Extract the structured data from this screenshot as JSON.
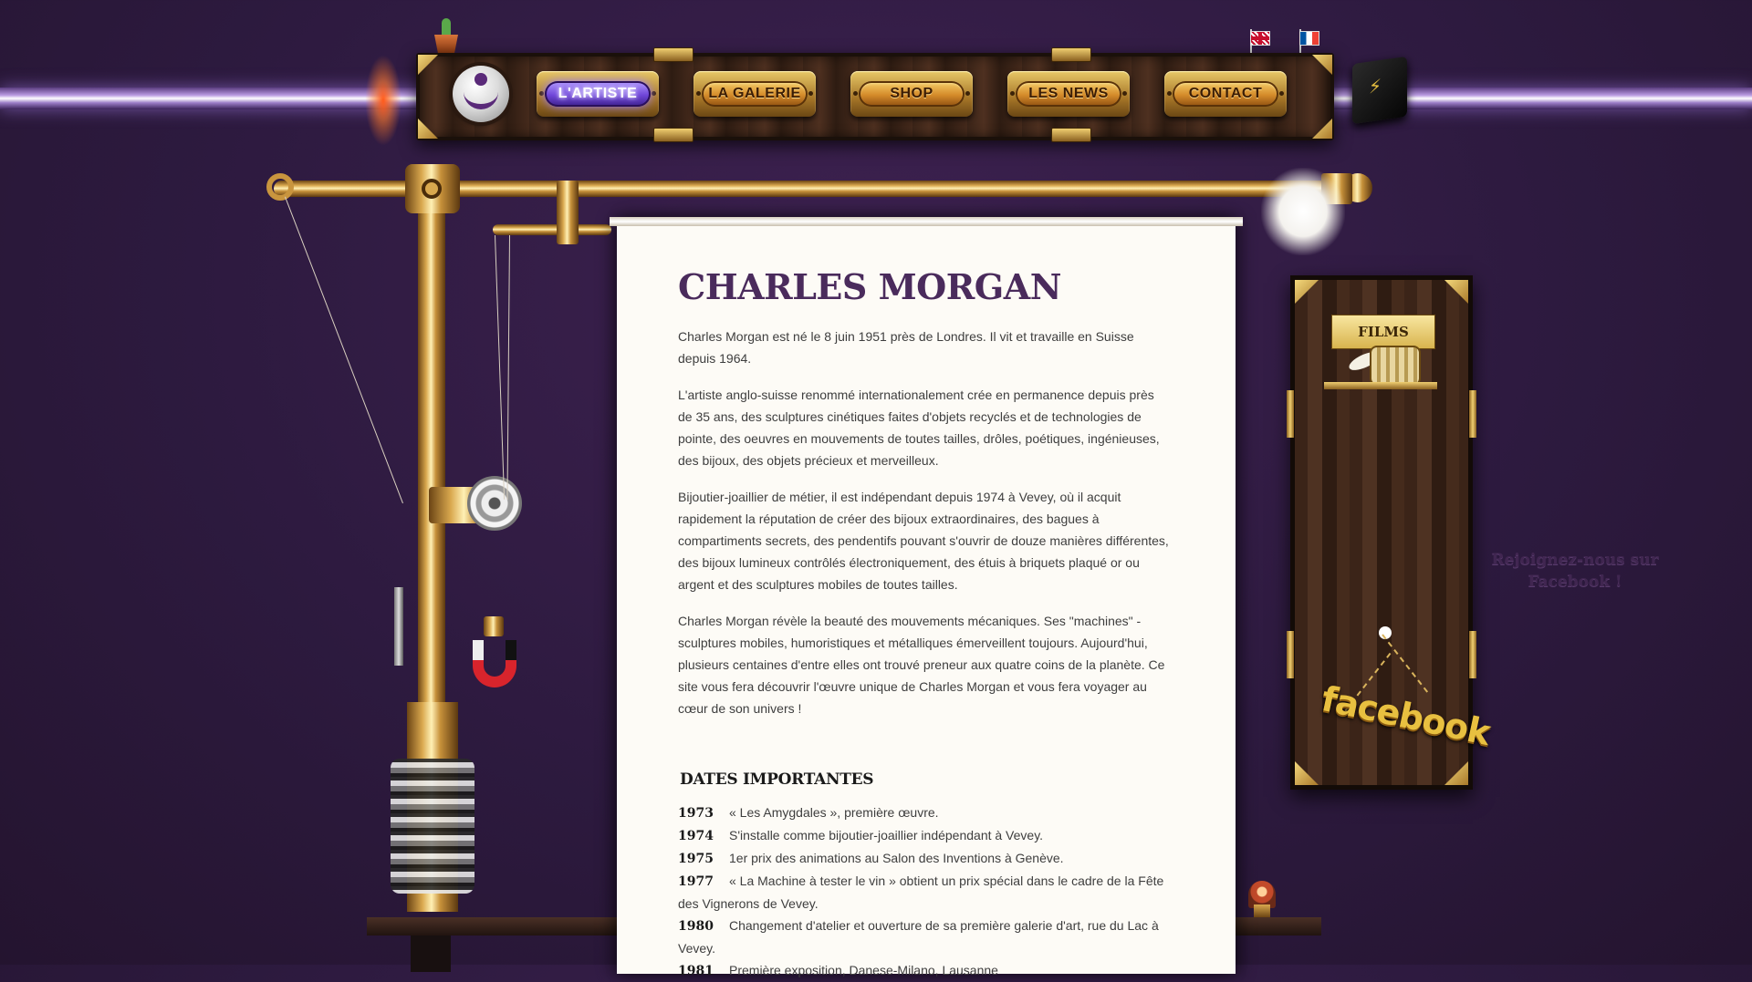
{
  "nav": {
    "items": [
      {
        "label": "L'ARTISTE",
        "active": true
      },
      {
        "label": "LA GALERIE",
        "active": false
      },
      {
        "label": "SHOP",
        "active": false
      },
      {
        "label": "LES NEWS",
        "active": false
      },
      {
        "label": "CONTACT",
        "active": false
      }
    ]
  },
  "languages": [
    "English",
    "Français"
  ],
  "article": {
    "title": "CHARLES MORGAN",
    "paragraphs": [
      "Charles Morgan est né le 8 juin 1951 près de Londres. Il vit et travaille en Suisse depuis 1964.",
      "L'artiste anglo-suisse renommé internationalement crée en permanence depuis près de 35 ans, des sculptures cinétiques faites d'objets recyclés et de technologies de pointe, des oeuvres en mouvements de toutes tailles, drôles, poétiques, ingénieuses, des bijoux, des objets précieux et merveilleux.",
      "Bijoutier-joaillier de métier, il est indépendant depuis 1974 à Vevey, où il acquit rapidement la réputation de créer des bijoux extraordinaires, des bagues à compartiments secrets, des pendentifs pouvant s'ouvrir de douze manières différentes, des bijoux lumineux contrôlés électroniquement, des étuis à briquets plaqué or ou argent et des sculptures mobiles de toutes tailles.",
      "Charles Morgan révèle la beauté des mouvements mécaniques. Ses \"machines\" - sculptures mobiles, humoristiques et métalliques émerveillent toujours. Aujourd'hui, plusieurs centaines d'entre elles ont trouvé preneur aux quatre coins de la planète. Ce site vous fera découvrir l'œuvre unique de Charles Morgan et vous fera voyager au cœur de son univers !"
    ],
    "dates_title": "DATES IMPORTANTES",
    "dates": [
      {
        "year": "1973",
        "text": "« Les Amygdales », première œuvre."
      },
      {
        "year": "1974",
        "text": "S'installe comme bijoutier-joaillier indépendant à Vevey."
      },
      {
        "year": "1975",
        "text": "1er prix des animations au Salon des Inventions à Genève."
      },
      {
        "year": "1977",
        "text": "« La Machine à tester le vin » obtient un prix spécial dans le cadre de la Fête des Vignerons de Vevey."
      },
      {
        "year": "1980",
        "text": "Changement d'atelier et ouverture de sa première galerie d'art, rue du Lac à Vevey."
      },
      {
        "year": "1981",
        "text": "Première exposition, Danese-Milano, Lausanne"
      }
    ]
  },
  "sidebar": {
    "films_label": "FILMS",
    "facebook_label": "facebook",
    "facebook_join": "Rejoignez-nous sur Facebook !"
  },
  "colors": {
    "background": "#2d1a3f",
    "title": "#4a2b5c",
    "brass": "#d9a84e",
    "active_button": "#6f45d8"
  }
}
